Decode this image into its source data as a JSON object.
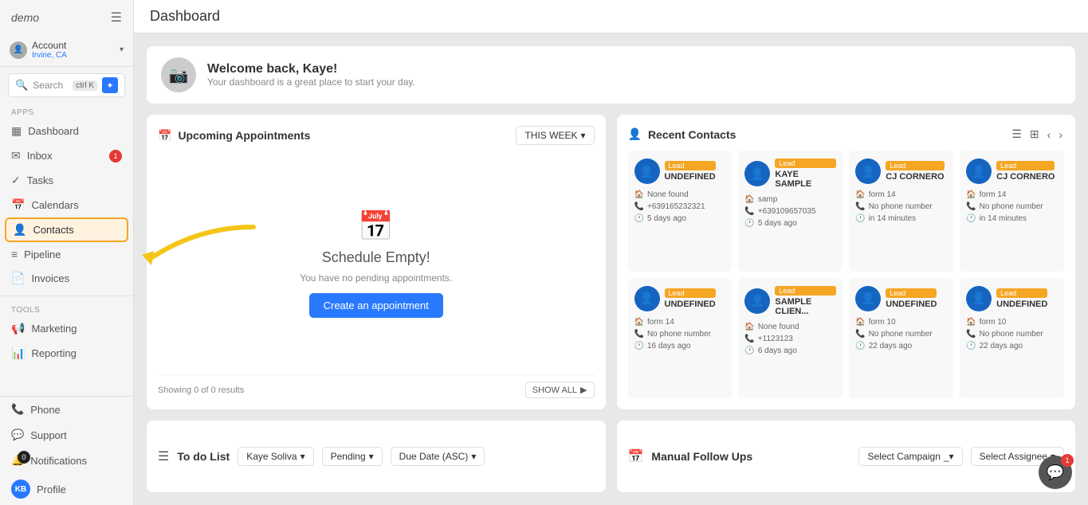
{
  "app": {
    "logo": "demo",
    "title": "Dashboard"
  },
  "account": {
    "name": "Account",
    "location": "Irvine, CA"
  },
  "search": {
    "placeholder": "Search",
    "shortcut": "ctrl K"
  },
  "sidebar": {
    "apps_label": "Apps",
    "tools_label": "Tools",
    "items": [
      {
        "label": "Dashboard",
        "icon": "▦",
        "active": false,
        "badge": null
      },
      {
        "label": "Inbox",
        "icon": "✉",
        "active": false,
        "badge": "1"
      },
      {
        "label": "Tasks",
        "icon": "✓",
        "active": false,
        "badge": null
      },
      {
        "label": "Calendars",
        "icon": "📅",
        "active": false,
        "badge": null
      },
      {
        "label": "Contacts",
        "icon": "👤",
        "active": true,
        "badge": null
      },
      {
        "label": "Pipeline",
        "icon": "≡",
        "active": false,
        "badge": null
      },
      {
        "label": "Invoices",
        "icon": "📄",
        "active": false,
        "badge": null
      }
    ],
    "tools": [
      {
        "label": "Marketing",
        "icon": "📢"
      },
      {
        "label": "Reporting",
        "icon": "📊"
      }
    ],
    "bottom": [
      {
        "label": "Phone",
        "icon": "📞"
      },
      {
        "label": "Support",
        "icon": "💬"
      },
      {
        "label": "Notifications",
        "icon": "🔔",
        "badge": "0"
      },
      {
        "label": "Profile",
        "icon": "KB",
        "isAvatar": true
      }
    ]
  },
  "welcome": {
    "title": "Welcome back, Kaye!",
    "subtitle": "Your dashboard is a great place to start your day."
  },
  "appointments": {
    "title": "Upcoming Appointments",
    "filter": "THIS WEEK",
    "empty_icon": "📅",
    "empty_title": "Schedule Empty!",
    "empty_sub": "You have no pending appointments.",
    "create_btn": "Create an appointment",
    "footer_text": "Showing 0 of 0 results",
    "show_all": "SHOW ALL"
  },
  "contacts": {
    "title": "Recent Contacts",
    "cards": [
      {
        "name": "UNDEFINED",
        "badge": "Lead",
        "field1": "None found",
        "phone": "+639165232321",
        "time": "5 days ago"
      },
      {
        "name": "KAYE SAMPLE",
        "badge": "Lead",
        "field1": "samp",
        "phone": "+639109657035",
        "time": "5 days ago"
      },
      {
        "name": "CJ CORNERO",
        "badge": "Lead",
        "field1": "form 14",
        "phone": "No phone number",
        "time": "in 14 minutes"
      },
      {
        "name": "CJ CORNERO",
        "badge": "Lead",
        "field1": "form 14",
        "phone": "No phone number",
        "time": "in 14 minutes"
      },
      {
        "name": "UNDEFINED",
        "badge": "Lead",
        "field1": "form 14",
        "phone": "No phone number",
        "time": "16 days ago"
      },
      {
        "name": "SAMPLE CLIEN...",
        "badge": "Lead",
        "field1": "None found",
        "phone": "+1123123",
        "time": "6 days ago"
      },
      {
        "name": "UNDEFINED",
        "badge": "Lead",
        "field1": "form 10",
        "phone": "No phone number",
        "time": "22 days ago"
      },
      {
        "name": "UNDEFINED",
        "badge": "Lead",
        "field1": "form 10",
        "phone": "No phone number",
        "time": "22 days ago"
      }
    ]
  },
  "todo": {
    "title": "To do List",
    "assignee": "Kaye Soliva",
    "status": "Pending",
    "sort": "Due Date (ASC)"
  },
  "followups": {
    "title": "Manual Follow Ups",
    "select_campaign": "Select Campaign",
    "select_assignee": "Select Assignee"
  },
  "chat": {
    "badge": "1"
  }
}
